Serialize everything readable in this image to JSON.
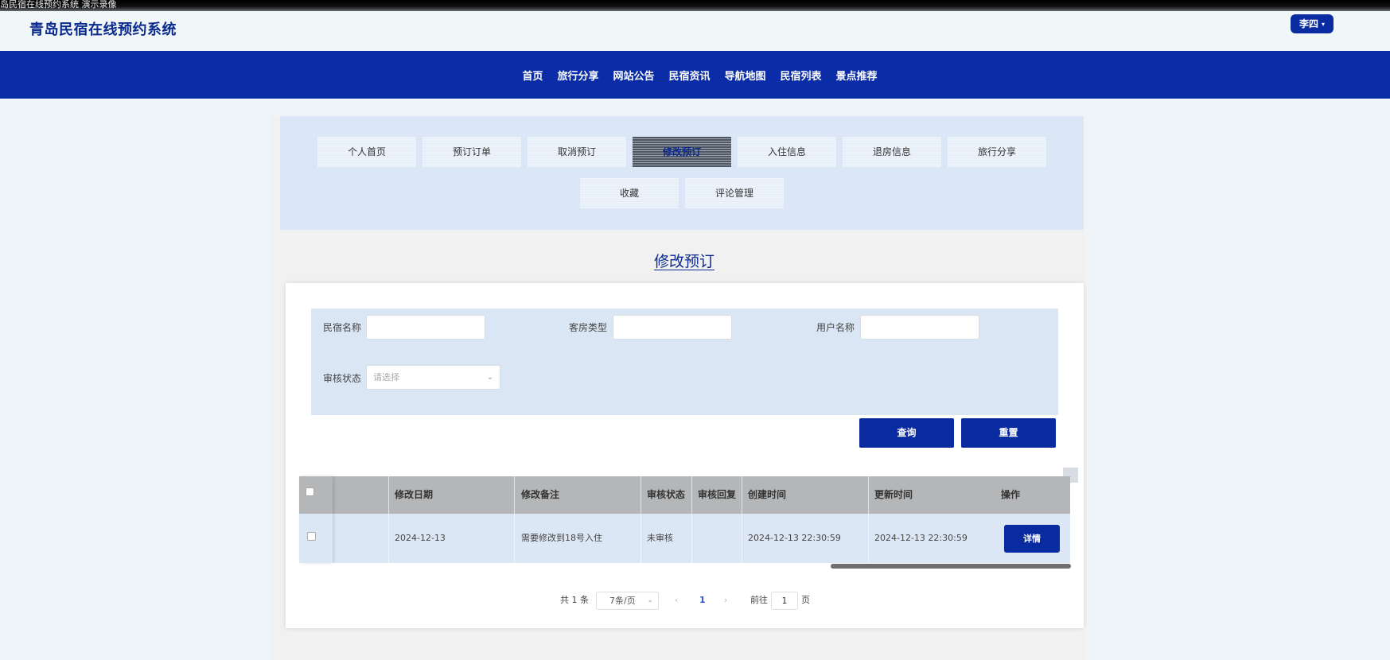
{
  "recording_banner": "岛民宿在线预约系统  演示录像",
  "site_title": "青岛民宿在线预约系统",
  "user_menu": {
    "name": "李四"
  },
  "nav": [
    "首页",
    "旅行分享",
    "网站公告",
    "民宿资讯",
    "导航地图",
    "民宿列表",
    "景点推荐"
  ],
  "tabs": [
    "个人首页",
    "预订订单",
    "取消预订",
    "修改预订",
    "入住信息",
    "退房信息",
    "旅行分享",
    "收藏",
    "评论管理"
  ],
  "active_tab": "修改预订",
  "page_title": "修改预订",
  "filters": {
    "homestay_name_label": "民宿名称",
    "room_type_label": "客房类型",
    "username_label": "用户名称",
    "status_label": "审核状态",
    "status_placeholder": "请选择",
    "query_button": "查询",
    "reset_button": "重置"
  },
  "table": {
    "headers": [
      "修改日期",
      "修改备注",
      "审核状态",
      "审核回复",
      "创建时间",
      "更新时间",
      "操作"
    ],
    "rows": [
      {
        "date": "2024-12-13",
        "remark": "需要修改到18号入住",
        "status": "未审核",
        "reply": "",
        "created": "2024-12-13 22:30:59",
        "updated": "2024-12-13 22:30:59",
        "action": "详情"
      }
    ]
  },
  "pagination": {
    "total": "共 1 条",
    "page_size": "7条/页",
    "prev": "‹",
    "current": "1",
    "next": "›",
    "goto_label": "前往",
    "goto_value": "1",
    "page_suffix": "页"
  },
  "colors": {
    "brand": "#0a2ca7",
    "title": "#0a2a8e"
  }
}
